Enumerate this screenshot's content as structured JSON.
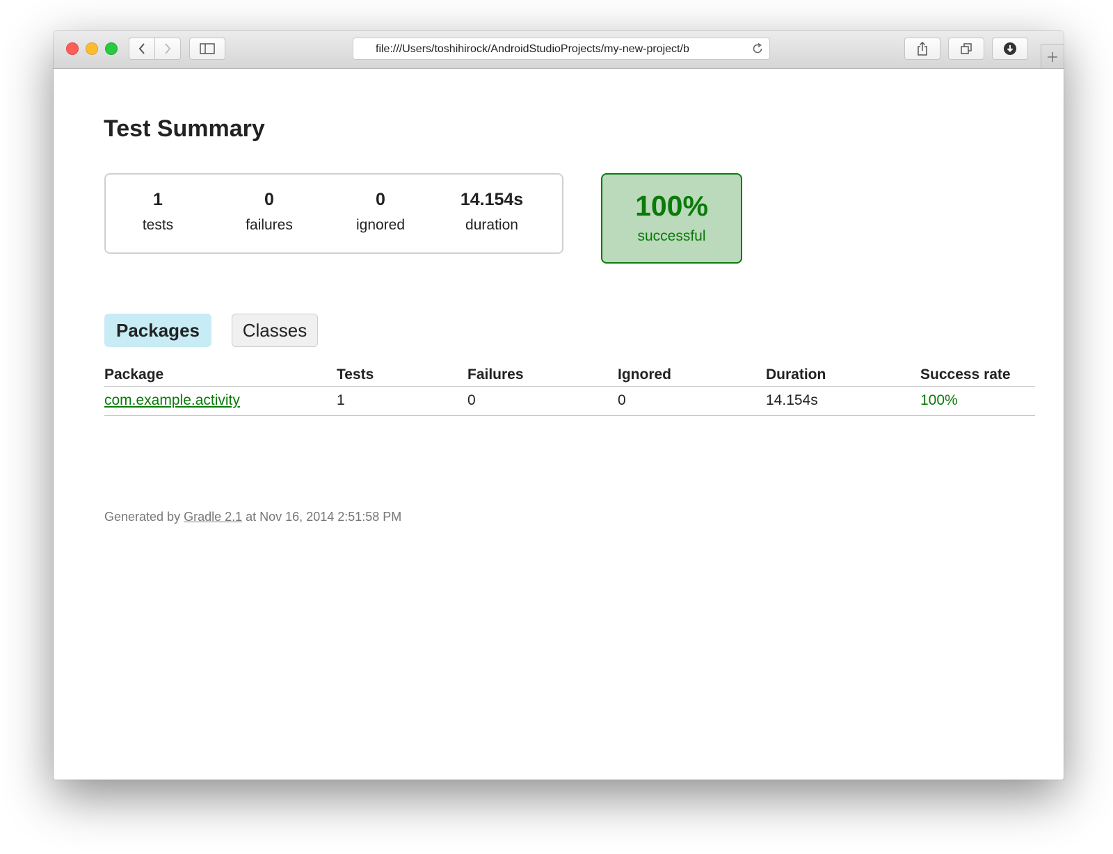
{
  "browser": {
    "url": "file:///Users/toshihirock/AndroidStudioProjects/my-new-project/b"
  },
  "page": {
    "title": "Test Summary"
  },
  "summary": {
    "tests": {
      "value": "1",
      "label": "tests"
    },
    "failures": {
      "value": "0",
      "label": "failures"
    },
    "ignored": {
      "value": "0",
      "label": "ignored"
    },
    "duration": {
      "value": "14.154s",
      "label": "duration"
    },
    "success": {
      "value": "100%",
      "label": "successful"
    }
  },
  "tabs": [
    {
      "label": "Packages",
      "selected": true
    },
    {
      "label": "Classes",
      "selected": false
    }
  ],
  "table": {
    "headers": [
      "Package",
      "Tests",
      "Failures",
      "Ignored",
      "Duration",
      "Success rate"
    ],
    "rows": [
      {
        "package": "com.example.activity",
        "tests": "1",
        "failures": "0",
        "ignored": "0",
        "duration": "14.154s",
        "success_rate": "100%"
      }
    ]
  },
  "footer": {
    "prefix": "Generated by ",
    "link": "Gradle 2.1",
    "suffix": " at Nov 16, 2014 2:51:58 PM"
  },
  "colors": {
    "success_green": "#0a7a0a",
    "success_bg": "#bbd9bb",
    "selected_tab_bg": "#c8ecf5"
  },
  "icons": {
    "back": "chevron-left-icon",
    "forward": "chevron-right-icon",
    "sidebar": "sidebar-icon",
    "reload": "reload-icon",
    "share": "share-icon",
    "tabs": "tabs-overview-icon",
    "download": "download-icon",
    "new_tab": "plus-icon"
  }
}
